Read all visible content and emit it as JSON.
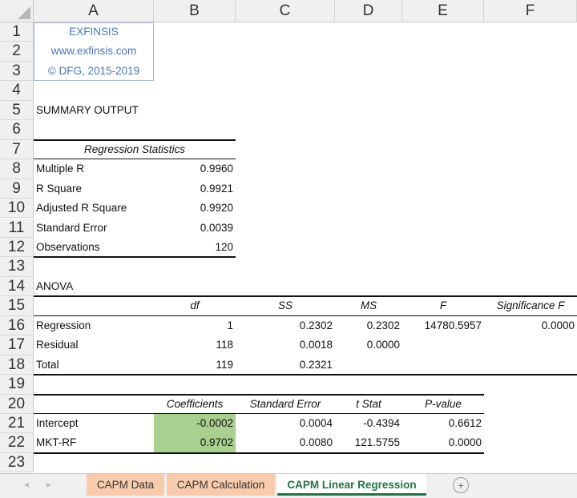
{
  "columns": [
    "A",
    "B",
    "C",
    "D",
    "E",
    "F"
  ],
  "rows": [
    "1",
    "2",
    "3",
    "4",
    "5",
    "6",
    "7",
    "8",
    "9",
    "10",
    "11",
    "12",
    "13",
    "14",
    "15",
    "16",
    "17",
    "18",
    "19",
    "20",
    "21",
    "22",
    "23"
  ],
  "brand": {
    "name": "EXFINSIS",
    "url": "www.exfinsis.com",
    "copyright": "© DFG, 2015-2019"
  },
  "summary_title": "SUMMARY OUTPUT",
  "regression_statistics": {
    "header": "Regression Statistics",
    "items": [
      {
        "label": "Multiple R",
        "value": "0.9960"
      },
      {
        "label": "R Square",
        "value": "0.9921"
      },
      {
        "label": "Adjusted R Square",
        "value": "0.9920"
      },
      {
        "label": "Standard Error",
        "value": "0.0039"
      },
      {
        "label": "Observations",
        "value": "120"
      }
    ]
  },
  "anova": {
    "title": "ANOVA",
    "headers": [
      "",
      "df",
      "SS",
      "MS",
      "F",
      "Significance F"
    ],
    "rows": [
      [
        "Regression",
        "1",
        "0.2302",
        "0.2302",
        "14780.5957",
        "0.0000"
      ],
      [
        "Residual",
        "118",
        "0.0018",
        "0.0000",
        "",
        ""
      ],
      [
        "Total",
        "119",
        "0.2321",
        "",
        "",
        ""
      ]
    ]
  },
  "coefficients": {
    "headers": [
      "",
      "Coefficients",
      "Standard Error",
      "t Stat",
      "P-value"
    ],
    "rows": [
      [
        "Intercept",
        "-0.0002",
        "0.0004",
        "-0.4394",
        "0.6612"
      ],
      [
        "MKT-RF",
        "0.9702",
        "0.0080",
        "121.5755",
        "0.0000"
      ]
    ]
  },
  "tabs": [
    {
      "label": "CAPM Data",
      "active": false
    },
    {
      "label": "CAPM Calculation",
      "active": false
    },
    {
      "label": "CAPM Linear Regression",
      "active": true
    }
  ],
  "colors": {
    "green_fill": "#a9d08e",
    "tab_orange": "#f8cbad",
    "active_tab": "#217346",
    "brand": "#4a73b8"
  }
}
